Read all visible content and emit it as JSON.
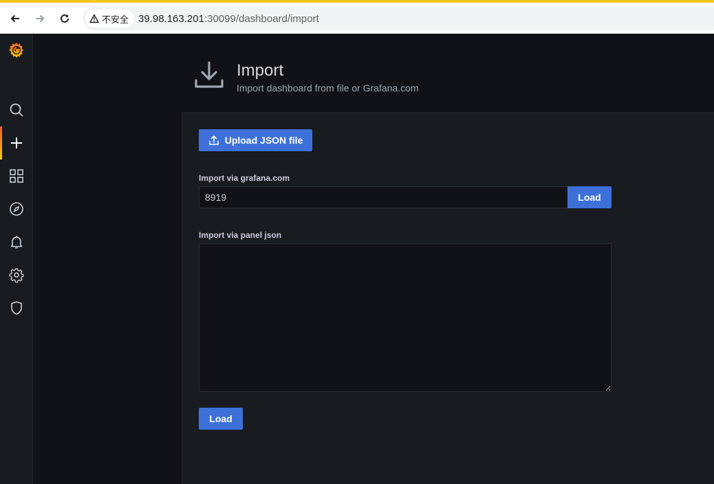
{
  "browser": {
    "security_label": "不安全",
    "url_host": "39.98.163.201",
    "url_rest": ":30099/dashboard/import"
  },
  "sidebar": {
    "items": [
      {
        "icon": "grafana-logo-icon"
      },
      {
        "icon": "search-icon"
      },
      {
        "icon": "plus-icon",
        "active": true
      },
      {
        "icon": "dashboards-icon"
      },
      {
        "icon": "compass-icon"
      },
      {
        "icon": "bell-icon"
      },
      {
        "icon": "gear-icon"
      },
      {
        "icon": "shield-icon"
      }
    ]
  },
  "header": {
    "title": "Import",
    "subtitle": "Import dashboard from file or Grafana.com"
  },
  "main": {
    "upload_label": "Upload JSON file",
    "gcom_label": "Import via grafana.com",
    "gcom_value": "8919",
    "gcom_load_label": "Load",
    "json_label": "Import via panel json",
    "json_value": "",
    "json_load_label": "Load"
  },
  "colors": {
    "accent": "#3d71d9",
    "background": "#111217",
    "panel": "#181b1f",
    "grafana_orange": "#f05a28"
  }
}
